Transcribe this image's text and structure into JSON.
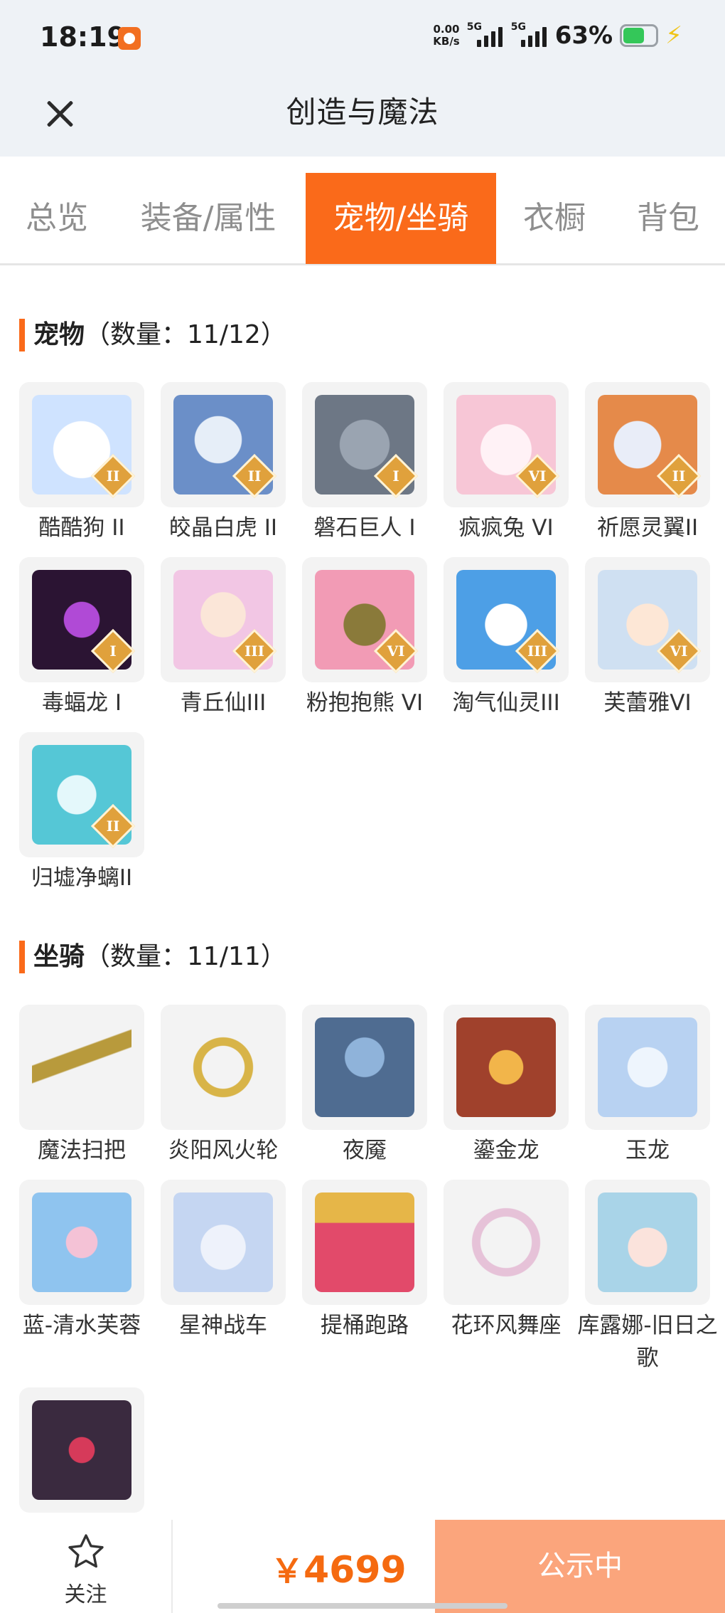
{
  "status_bar": {
    "time": "18:19",
    "net_speed_value": "0.00",
    "net_speed_unit": "KB/s",
    "sim1": "5G",
    "sim2": "5G",
    "battery": "63%"
  },
  "header": {
    "title": "创造与魔法"
  },
  "tabs": [
    {
      "label": "总览",
      "active": false
    },
    {
      "label": "装备/属性",
      "active": false
    },
    {
      "label": "宠物/坐骑",
      "active": true
    },
    {
      "label": "衣橱",
      "active": false
    },
    {
      "label": "背包",
      "active": false
    }
  ],
  "pets": {
    "title": "宠物",
    "count": "（数量：11/12）",
    "items": [
      {
        "name": "酷酷狗 II",
        "level": "II",
        "icon": "bear-ski-goggles-icon",
        "color": "#cfe3ff"
      },
      {
        "name": "皎晶白虎 II",
        "level": "II",
        "icon": "white-tiger-icon",
        "color": "#6b8fc8"
      },
      {
        "name": "磐石巨人 I",
        "level": "I",
        "icon": "rock-giant-icon",
        "color": "#6d7785"
      },
      {
        "name": "疯疯兔 VI",
        "level": "VI",
        "icon": "pink-rabbit-icon",
        "color": "#f7c6d6"
      },
      {
        "name": "祈愿灵翼II",
        "level": "II",
        "icon": "griffin-icon",
        "color": "#e58a4a"
      },
      {
        "name": "毒蝠龙 I",
        "level": "I",
        "icon": "poison-bat-dragon-icon",
        "color": "#6a2c8c"
      },
      {
        "name": "青丘仙III",
        "level": "III",
        "icon": "fox-fairy-icon",
        "color": "#f2c6e4"
      },
      {
        "name": "粉抱抱熊 VI",
        "level": "VI",
        "icon": "pink-bear-icon",
        "color": "#f29bb5"
      },
      {
        "name": "淘气仙灵III",
        "level": "III",
        "icon": "blue-dog-icon",
        "color": "#4d9fe6"
      },
      {
        "name": "芙蕾雅VI",
        "level": "VI",
        "icon": "goddess-icon",
        "color": "#cfe0f2"
      },
      {
        "name": "归墟净螭II",
        "level": "II",
        "icon": "cyan-dragon-icon",
        "color": "#55c7d6"
      }
    ]
  },
  "mounts": {
    "title": "坐骑",
    "count": "（数量：11/11）",
    "items": [
      {
        "name": "魔法扫把",
        "icon": "magic-broom-icon",
        "color": "#b89a3c"
      },
      {
        "name": "炎阳风火轮",
        "icon": "fire-wheel-icon",
        "color": "#d8b448"
      },
      {
        "name": "夜魇",
        "icon": "night-horse-icon",
        "color": "#4f6c91"
      },
      {
        "name": "鎏金龙",
        "icon": "golden-dragon-icon",
        "color": "#a0412c"
      },
      {
        "name": "玉龙",
        "icon": "jade-dragon-icon",
        "color": "#b8d2f2"
      },
      {
        "name": "蓝-清水芙蓉",
        "icon": "blue-lotus-icon",
        "color": "#8fc4ef"
      },
      {
        "name": "星神战车",
        "icon": "star-chariot-icon",
        "color": "#c5d6f2"
      },
      {
        "name": "提桶跑路",
        "icon": "bucket-icon",
        "color": "#e24a6a"
      },
      {
        "name": "花环风舞座",
        "icon": "flower-wreath-icon",
        "color": "#e6c2d8"
      },
      {
        "name": "库露娜-旧日之歌",
        "icon": "sheep-girl-icon",
        "color": "#a9d4e8"
      },
      {
        "name": "",
        "icon": "dark-dragon-icon",
        "color": "#3a2a3f"
      }
    ]
  },
  "bottom_bar": {
    "follow_label": "关注",
    "price_currency": "￥",
    "price_value": "4699",
    "status_label": "公示中"
  }
}
